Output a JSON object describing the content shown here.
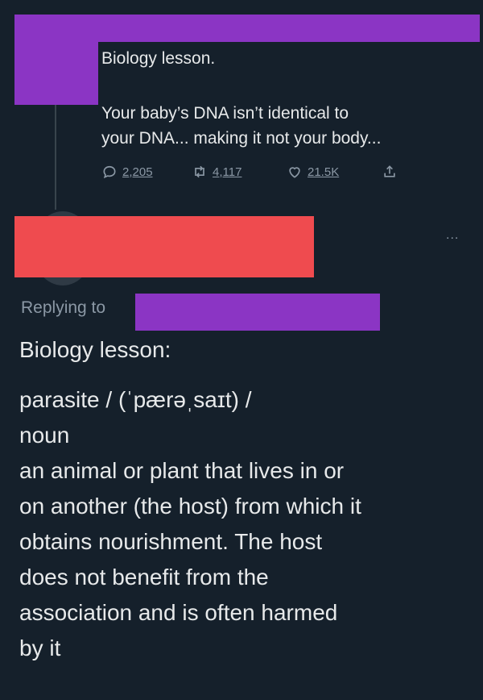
{
  "tweet1": {
    "title": "Biology lesson.",
    "body": "Your baby’s DNA isn’t identical to your DNA... making it not your body...",
    "line1": "Your baby’s DNA isn’t identical to",
    "line2": "your DNA... making it not your body...",
    "actions": {
      "reply_count": "2,205",
      "retweet_count": "4,117",
      "like_count": "21.5K"
    }
  },
  "tweet2": {
    "more_label": "...",
    "replying_to_label": "Replying to",
    "heading": "Biology lesson:",
    "lines": [
      "parasite / (ˈpærəˌsaɪt) /",
      "noun",
      "an animal or plant that lives in or",
      "on another (the host) from which it",
      "obtains nourishment. The host",
      "does not benefit from the",
      "association and is often harmed",
      "by it"
    ]
  },
  "colors": {
    "background": "#15202b",
    "text": "#e7e9ea",
    "muted": "#8b98a5",
    "redaction_purple": "#8b35c4",
    "redaction_red": "#ef4b4f"
  },
  "icons": [
    "reply-icon",
    "retweet-icon",
    "like-icon",
    "share-icon",
    "more-icon"
  ]
}
